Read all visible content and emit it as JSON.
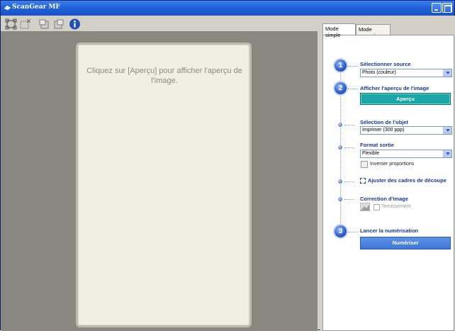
{
  "window": {
    "title": "ScanGear MF",
    "colors": {
      "titlebar": "#2261d9",
      "preview_bg": "#888880",
      "accent_step": "#2d62c9",
      "label": "#153a9d",
      "preview_button": "#1aa7a5"
    }
  },
  "toolbar": {
    "tools": [
      "auto-crop-icon",
      "clear-crop-icon",
      "rotate-left-icon",
      "rotate-right-icon",
      "info-icon"
    ]
  },
  "preview": {
    "hint": "Cliquez sur [Aperçu] pour afficher l'aperçu de l'image."
  },
  "tabs": [
    {
      "label": "Mode simple",
      "active": true
    },
    {
      "label": "Mode avancé",
      "active": false
    }
  ],
  "steps": {
    "step1": {
      "number": "1",
      "label": "Sélectionner source",
      "select_value": "Photo (couleur)"
    },
    "step2": {
      "number": "2",
      "label": "Afficher l'aperçu de l'image",
      "button": "Aperçu"
    },
    "object": {
      "label": "Sélection de l'objet",
      "select_value": "Imprimer (300 ppp)"
    },
    "output": {
      "label": "Format sortie",
      "select_value": "Flexible",
      "checkbox_label": "Inverser proportions"
    },
    "crop": {
      "label": "Ajuster des cadres de découpe"
    },
    "correction": {
      "label": "Correction d'image",
      "checkbox_label": "Ternissement"
    },
    "step3": {
      "number": "3",
      "label": "Lancer la numérisation",
      "button": "Numériser"
    }
  }
}
